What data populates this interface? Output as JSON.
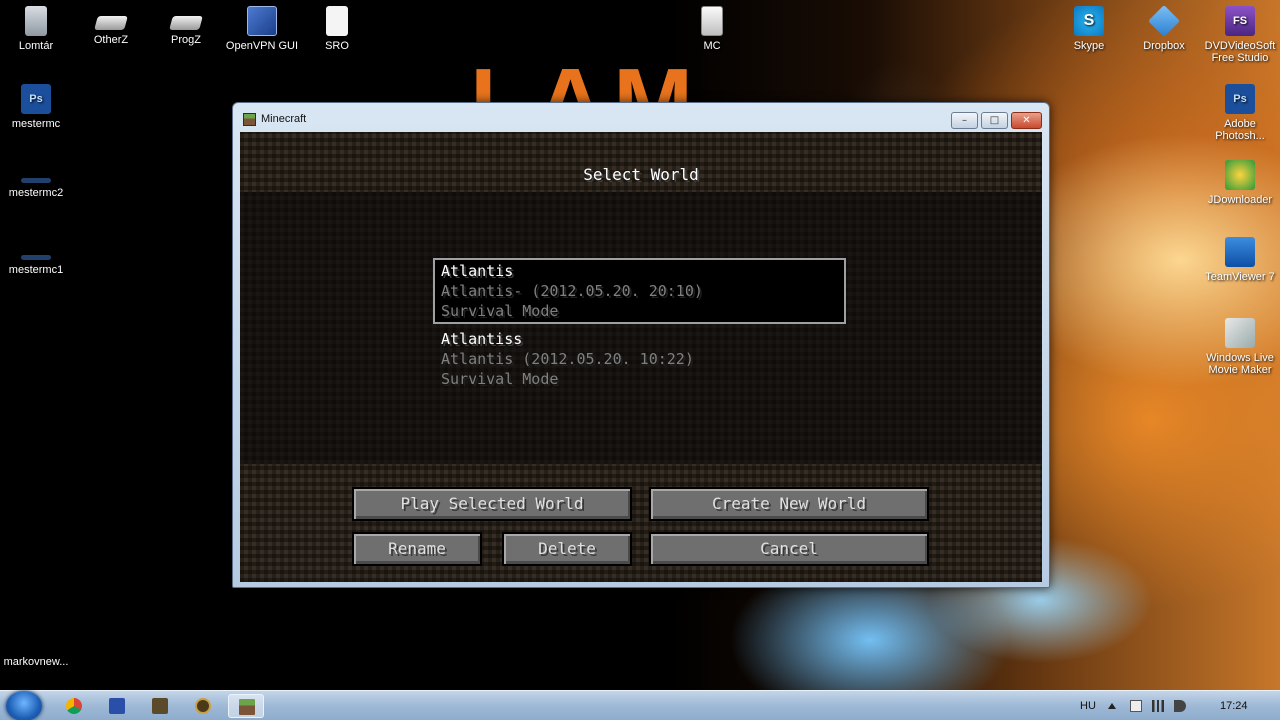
{
  "desktop": {
    "wallpaper_title": "I AM",
    "left_icons": [
      {
        "label": "Lomtár",
        "icon": "recycle-bin-icon"
      },
      {
        "label": "OtherZ",
        "icon": "drive-icon"
      },
      {
        "label": "ProgZ",
        "icon": "drive-icon"
      },
      {
        "label": "OpenVPN GUI",
        "icon": "openvpn-icon"
      },
      {
        "label": "SRO",
        "icon": "file-icon"
      },
      {
        "label": "MC",
        "icon": "minecraft-file-icon"
      },
      {
        "label": "mestermc",
        "icon": "photoshop-file-icon"
      },
      {
        "label": "mestermc2",
        "icon": "file-icon"
      },
      {
        "label": "mestermc1",
        "icon": "file-icon"
      },
      {
        "label": "markovnew...",
        "icon": "file-icon"
      }
    ],
    "right_icons": [
      {
        "label": "Skype",
        "icon": "skype-icon"
      },
      {
        "label": "Dropbox",
        "icon": "dropbox-icon"
      },
      {
        "label": "DVDVideoSoft Free Studio",
        "icon": "dvdvideosoft-icon"
      },
      {
        "label": "Adobe Photosh...",
        "icon": "photoshop-icon"
      },
      {
        "label": "JDownloader",
        "icon": "jdownloader-icon"
      },
      {
        "label": "TeamViewer 7",
        "icon": "teamviewer-icon"
      },
      {
        "label": "Windows Live Movie Maker",
        "icon": "movie-maker-icon"
      }
    ]
  },
  "window": {
    "title": "Minecraft",
    "controls": {
      "minimize": "–",
      "maximize": "□",
      "close": "✕"
    }
  },
  "minecraft": {
    "heading": "Select World",
    "worlds": [
      {
        "name": "Atlantis",
        "detail": "Atlantis- (2012.05.20. 20:10)",
        "mode": "Survival Mode",
        "selected": true
      },
      {
        "name": "Atlantiss",
        "detail": "Atlantis (2012.05.20. 10:22)",
        "mode": "Survival Mode",
        "selected": false
      }
    ],
    "buttons": {
      "play": "Play Selected World",
      "create": "Create New World",
      "rename": "Rename",
      "delete": "Delete",
      "cancel": "Cancel"
    }
  },
  "taskbar": {
    "apps": [
      "windows-explorer",
      "chrome",
      "save",
      "media-player",
      "warcraft",
      "minecraft"
    ],
    "language": "HU",
    "clock": "17:24"
  },
  "colors": {
    "accent_taskbar": "#9fb9d6",
    "mc_button": "#6f6f6f",
    "wallpaper_title": "#e8731c"
  }
}
